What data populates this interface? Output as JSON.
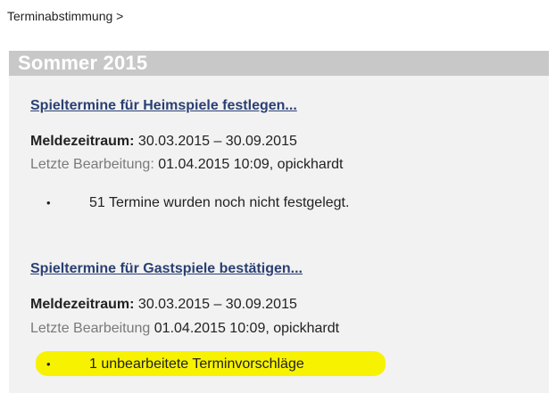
{
  "breadcrumb": "Terminabstimmung >",
  "panel": {
    "title": "Sommer 2015",
    "sections": [
      {
        "link": "Spieltermine für Heimspiele festlegen...",
        "period_label": "Meldezeitraum:",
        "period_value": "30.03.2015 – 30.09.2015",
        "last_edit_label": "Letzte Bearbeitung:",
        "last_edit_value": "01.04.2015 10:09, opickhardt",
        "bullet": "51 Termine wurden noch nicht festgelegt."
      },
      {
        "link": "Spieltermine für Gastspiele bestätigen...",
        "period_label": "Meldezeitraum:",
        "period_value": "30.03.2015 – 30.09.2015",
        "last_edit_label": "Letzte Bearbeitung",
        "last_edit_value": "01.04.2015 10:09, opickhardt",
        "bullet": "1 unbearbeitete Terminvorschläge"
      }
    ]
  },
  "colors": {
    "header_bg": "#c8c8c8",
    "panel_bg": "#f2f2f2",
    "link": "#2a3f73",
    "highlight": "#f7f200"
  }
}
